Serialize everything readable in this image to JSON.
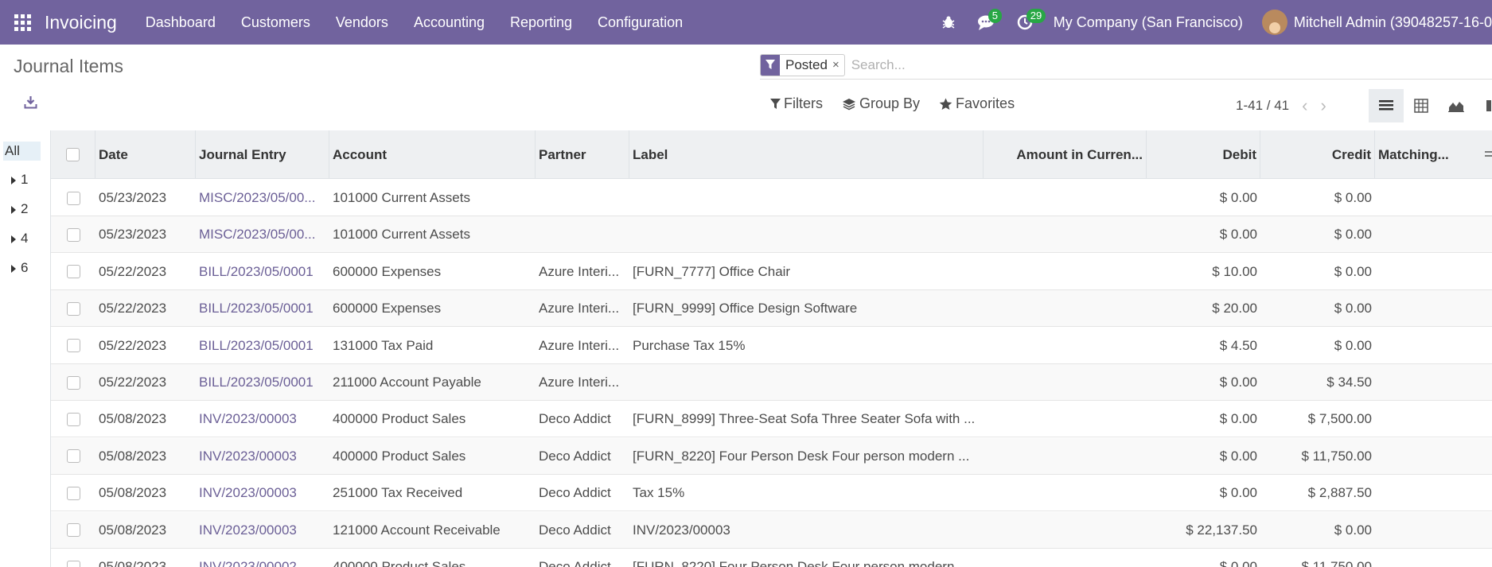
{
  "navbar": {
    "app_name": "Invoicing",
    "menu": [
      "Dashboard",
      "Customers",
      "Vendors",
      "Accounting",
      "Reporting",
      "Configuration"
    ],
    "messages_count": "5",
    "activities_count": "29",
    "company": "My Company (San Francisco)",
    "user": "Mitchell Admin (39048257-16-0"
  },
  "page": {
    "title": "Journal Items"
  },
  "search": {
    "facet": "Posted",
    "remove": "×",
    "placeholder": "Search..."
  },
  "filters": {
    "filters_label": "Filters",
    "groupby_label": "Group By",
    "favorites_label": "Favorites"
  },
  "pager": {
    "value": "1-41 / 41",
    "prev": "‹",
    "next": "›"
  },
  "sidepanel": {
    "items": [
      "All",
      "1",
      "2",
      "4",
      "6"
    ]
  },
  "table": {
    "headers": [
      "Date",
      "Journal Entry",
      "Account",
      "Partner",
      "Label",
      "Amount in Curren...",
      "Debit",
      "Credit",
      "Matching..."
    ],
    "rows": [
      {
        "date": "05/23/2023",
        "entry": "MISC/2023/05/00...",
        "account": "101000 Current Assets",
        "partner": "",
        "label": "",
        "amount": "",
        "debit": "$ 0.00",
        "credit": "$ 0.00"
      },
      {
        "date": "05/23/2023",
        "entry": "MISC/2023/05/00...",
        "account": "101000 Current Assets",
        "partner": "",
        "label": "",
        "amount": "",
        "debit": "$ 0.00",
        "credit": "$ 0.00"
      },
      {
        "date": "05/22/2023",
        "entry": "BILL/2023/05/0001",
        "account": "600000 Expenses",
        "partner": "Azure Interi...",
        "label": "[FURN_7777] Office Chair",
        "amount": "",
        "debit": "$ 10.00",
        "credit": "$ 0.00"
      },
      {
        "date": "05/22/2023",
        "entry": "BILL/2023/05/0001",
        "account": "600000 Expenses",
        "partner": "Azure Interi...",
        "label": "[FURN_9999] Office Design Software",
        "amount": "",
        "debit": "$ 20.00",
        "credit": "$ 0.00"
      },
      {
        "date": "05/22/2023",
        "entry": "BILL/2023/05/0001",
        "account": "131000 Tax Paid",
        "partner": "Azure Interi...",
        "label": "Purchase Tax 15%",
        "amount": "",
        "debit": "$ 4.50",
        "credit": "$ 0.00"
      },
      {
        "date": "05/22/2023",
        "entry": "BILL/2023/05/0001",
        "account": "211000 Account Payable",
        "partner": "Azure Interi...",
        "label": "",
        "amount": "",
        "debit": "$ 0.00",
        "credit": "$ 34.50"
      },
      {
        "date": "05/08/2023",
        "entry": "INV/2023/00003",
        "account": "400000 Product Sales",
        "partner": "Deco Addict",
        "label": "[FURN_8999] Three-Seat Sofa Three Seater Sofa with ...",
        "amount": "",
        "debit": "$ 0.00",
        "credit": "$ 7,500.00"
      },
      {
        "date": "05/08/2023",
        "entry": "INV/2023/00003",
        "account": "400000 Product Sales",
        "partner": "Deco Addict",
        "label": "[FURN_8220] Four Person Desk Four person modern ...",
        "amount": "",
        "debit": "$ 0.00",
        "credit": "$ 11,750.00"
      },
      {
        "date": "05/08/2023",
        "entry": "INV/2023/00003",
        "account": "251000 Tax Received",
        "partner": "Deco Addict",
        "label": "Tax 15%",
        "amount": "",
        "debit": "$ 0.00",
        "credit": "$ 2,887.50"
      },
      {
        "date": "05/08/2023",
        "entry": "INV/2023/00003",
        "account": "121000 Account Receivable",
        "partner": "Deco Addict",
        "label": "INV/2023/00003",
        "amount": "",
        "debit": "$ 22,137.50",
        "credit": "$ 0.00"
      },
      {
        "date": "05/08/2023",
        "entry": "INV/2023/00002",
        "account": "400000 Product Sales",
        "partner": "Deco Addict",
        "label": "[FURN_8220] Four Person Desk Four person modern ...",
        "amount": "",
        "debit": "$ 0.00",
        "credit": "$ 11,750.00"
      }
    ]
  },
  "colors": {
    "navbar": "#71639e",
    "link": "#6b5f96",
    "badge": "#28a745"
  }
}
